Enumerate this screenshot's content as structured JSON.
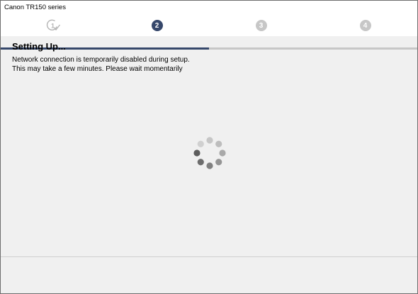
{
  "window": {
    "title": "Canon TR150 series"
  },
  "steps": {
    "step1": {
      "label": "1",
      "state": "completed"
    },
    "step2": {
      "label": "2",
      "state": "active"
    },
    "step3": {
      "label": "3",
      "state": "pending"
    },
    "step4": {
      "label": "4",
      "state": "pending"
    },
    "current_step": 2,
    "total_steps": 4
  },
  "content": {
    "heading": "Setting Up...",
    "line1": "Network connection is temporarily disabled during setup.",
    "line2": "This may take a few minutes. Please wait momentarily"
  },
  "colors": {
    "active_step": "#36486b",
    "inactive_step": "#c7c7c7",
    "progress_fill": "#36486b",
    "progress_track": "#c7c7c7",
    "background": "#f0f0f0"
  },
  "icons": {
    "completed_step": "check-circle-1-icon",
    "loading": "loading-spinner-icon"
  }
}
